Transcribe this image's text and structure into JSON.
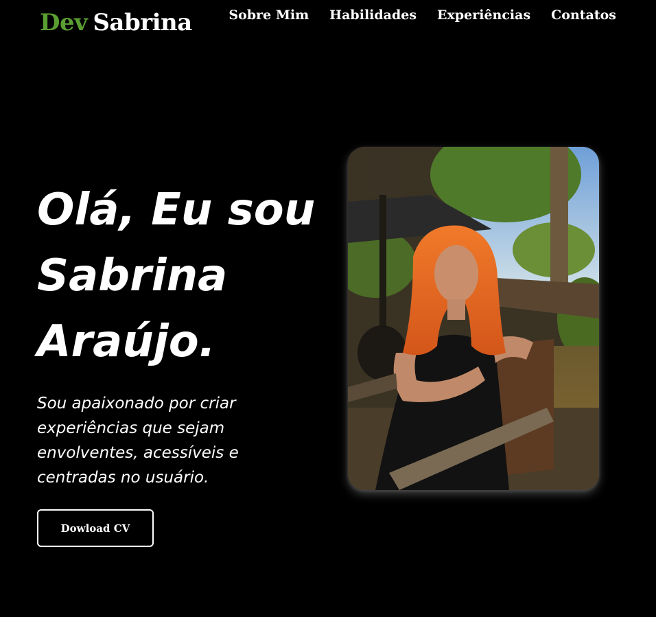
{
  "header": {
    "logo_dev": "Dev",
    "logo_name": "Sabrina",
    "nav": [
      {
        "label": "Sobre Mim"
      },
      {
        "label": "Habilidades"
      },
      {
        "label": "Experiências"
      },
      {
        "label": "Contatos"
      }
    ]
  },
  "hero": {
    "title": "Olá, Eu sou Sabrina Araújo.",
    "subtitle": "Sou apaixonado por criar experiências que sejam envolventes, acessíveis e centradas no usuário.",
    "cv_button": "Dowload CV"
  },
  "colors": {
    "background": "#000000",
    "accent": "#5a9e32",
    "text": "#ffffff"
  }
}
